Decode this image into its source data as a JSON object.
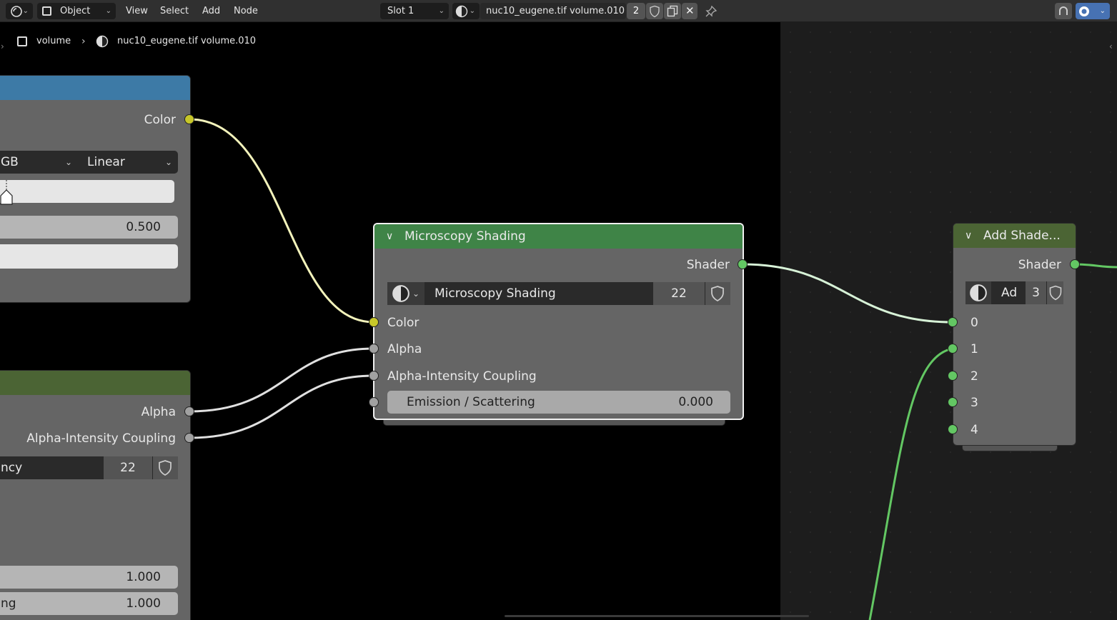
{
  "header": {
    "editor_type_icon": "node-editor-icon",
    "mode_label": "Object",
    "menus": [
      "View",
      "Select",
      "Add",
      "Node"
    ],
    "slot_label": "Slot 1",
    "material_name": "nuc10_eugene.tif volume.010",
    "user_count": "2"
  },
  "breadcrumb": {
    "object": "volume",
    "material": "nuc10_eugene.tif volume.010"
  },
  "left_node_top": {
    "output_label": "Color",
    "color_mode": "GB",
    "interpolation": "Linear",
    "value": "0.500"
  },
  "left_node_bottom": {
    "out_alpha": "Alpha",
    "out_coupling": "Alpha-Intensity Coupling",
    "datablock_name": "ncy",
    "datablock_users": "22",
    "value1": "1.000",
    "value2_label": "ng",
    "value2": "1.000"
  },
  "microscopy_node": {
    "title": "Microscopy Shading",
    "output_label": "Shader",
    "datablock_name": "Microscopy Shading",
    "datablock_users": "22",
    "inputs": [
      "Color",
      "Alpha",
      "Alpha-Intensity Coupling"
    ],
    "emission_label": "Emission / Scattering",
    "emission_value": "0.000"
  },
  "add_shader_node": {
    "title": "Add Shade...",
    "output_label": "Shader",
    "datablock_name": "Ad",
    "datablock_users": "3",
    "inputs": [
      "0",
      "1",
      "2",
      "3",
      "4"
    ]
  },
  "colors": {
    "blue_header": "#3d7aa6",
    "green_header": "#3f8447",
    "olive_header": "#4b6434",
    "color_socket": "#c7c729",
    "shader_socket": "#63c763",
    "float_socket": "#a1a1a1"
  }
}
